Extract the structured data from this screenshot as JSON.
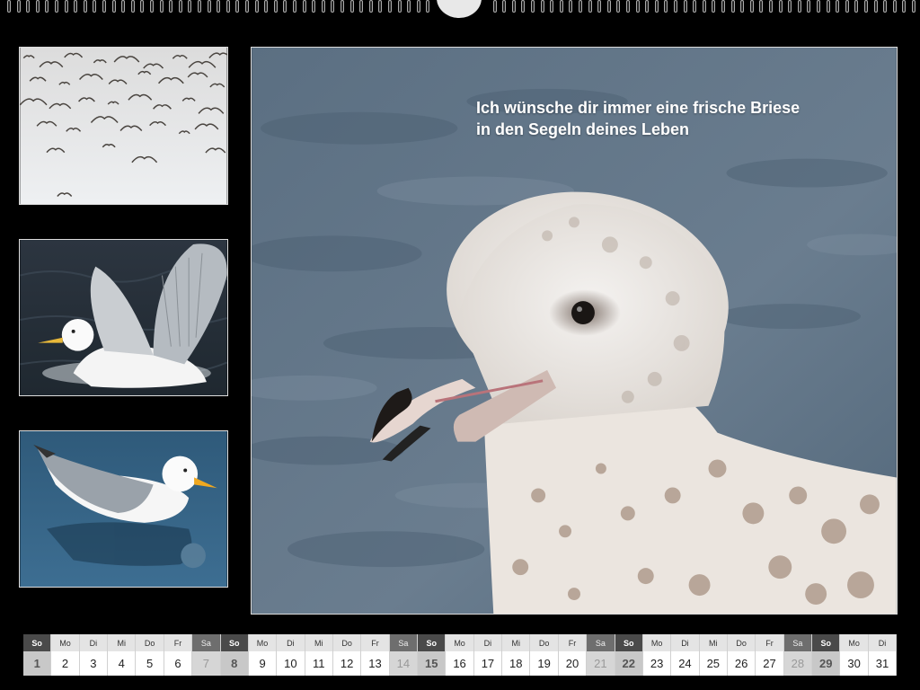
{
  "quote": {
    "line1": "Ich wünsche dir immer eine frische Briese",
    "line2": "in den Segeln deines Leben"
  },
  "images": {
    "thumb_top": "flock-of-seagulls-photo",
    "thumb_middle": "seagull-spreading-wings-photo",
    "thumb_bottom": "seagull-with-reflection-photo",
    "main": "juvenile-seagull-closeup-photo"
  },
  "calendar": {
    "days": [
      {
        "name": "So",
        "num": "1",
        "type": "sun"
      },
      {
        "name": "Mo",
        "num": "2",
        "type": "wd"
      },
      {
        "name": "Di",
        "num": "3",
        "type": "wd"
      },
      {
        "name": "Mi",
        "num": "4",
        "type": "wd"
      },
      {
        "name": "Do",
        "num": "5",
        "type": "wd"
      },
      {
        "name": "Fr",
        "num": "6",
        "type": "wd"
      },
      {
        "name": "Sa",
        "num": "7",
        "type": "sat"
      },
      {
        "name": "So",
        "num": "8",
        "type": "sun"
      },
      {
        "name": "Mo",
        "num": "9",
        "type": "wd"
      },
      {
        "name": "Di",
        "num": "10",
        "type": "wd"
      },
      {
        "name": "Mi",
        "num": "11",
        "type": "wd"
      },
      {
        "name": "Do",
        "num": "12",
        "type": "wd"
      },
      {
        "name": "Fr",
        "num": "13",
        "type": "wd"
      },
      {
        "name": "Sa",
        "num": "14",
        "type": "sat"
      },
      {
        "name": "So",
        "num": "15",
        "type": "sun"
      },
      {
        "name": "Mo",
        "num": "16",
        "type": "wd"
      },
      {
        "name": "Di",
        "num": "17",
        "type": "wd"
      },
      {
        "name": "Mi",
        "num": "18",
        "type": "wd"
      },
      {
        "name": "Do",
        "num": "19",
        "type": "wd"
      },
      {
        "name": "Fr",
        "num": "20",
        "type": "wd"
      },
      {
        "name": "Sa",
        "num": "21",
        "type": "sat"
      },
      {
        "name": "So",
        "num": "22",
        "type": "sun"
      },
      {
        "name": "Mo",
        "num": "23",
        "type": "wd"
      },
      {
        "name": "Di",
        "num": "24",
        "type": "wd"
      },
      {
        "name": "Mi",
        "num": "25",
        "type": "wd"
      },
      {
        "name": "Do",
        "num": "26",
        "type": "wd"
      },
      {
        "name": "Fr",
        "num": "27",
        "type": "wd"
      },
      {
        "name": "Sa",
        "num": "28",
        "type": "sat"
      },
      {
        "name": "So",
        "num": "29",
        "type": "sun"
      },
      {
        "name": "Mo",
        "num": "30",
        "type": "wd"
      },
      {
        "name": "Di",
        "num": "31",
        "type": "wd"
      }
    ]
  },
  "colors": {
    "background": "#000000",
    "water": "#5a6f82",
    "frame": "#dddddd"
  }
}
